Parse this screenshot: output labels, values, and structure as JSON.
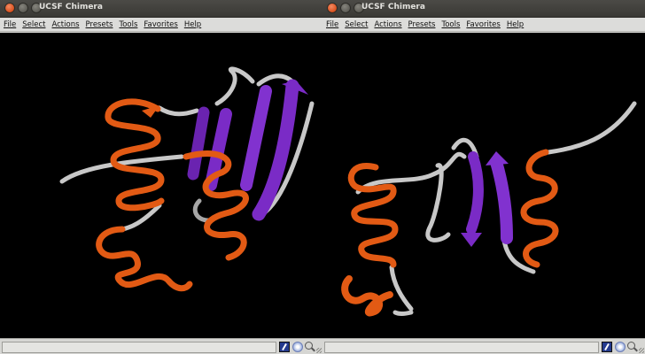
{
  "windows": [
    {
      "title": "UCSF Chimera",
      "menu": [
        "File",
        "Select",
        "Actions",
        "Presets",
        "Tools",
        "Favorites",
        "Help"
      ],
      "status_text": "",
      "icons": [
        "close-icon",
        "minimize-icon",
        "maximize-icon",
        "command-line-icon",
        "model-id-icon",
        "zoom-icon"
      ]
    },
    {
      "title": "UCSF Chimera",
      "menu": [
        "File",
        "Select",
        "Actions",
        "Presets",
        "Tools",
        "Favorites",
        "Help"
      ],
      "status_text": "",
      "icons": [
        "close-icon",
        "minimize-icon",
        "maximize-icon",
        "command-line-icon",
        "model-id-icon",
        "zoom-icon"
      ]
    }
  ],
  "colors": {
    "helix": "#e25a14",
    "sheet": "#7a2bc6",
    "coil": "#c8c8c8",
    "background": "#000000",
    "titlebar": "#3c3b37"
  }
}
